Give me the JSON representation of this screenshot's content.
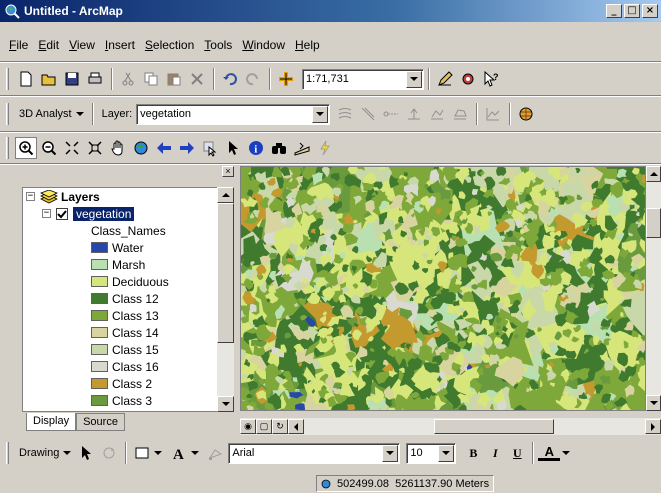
{
  "window": {
    "title": "Untitled - ArcMap",
    "app_icon": "globe-magnifier-icon"
  },
  "menu": [
    {
      "label": "File",
      "key": "F",
      "rest": "ile"
    },
    {
      "label": "Edit",
      "key": "E",
      "rest": "dit"
    },
    {
      "label": "View",
      "key": "V",
      "rest": "iew"
    },
    {
      "label": "Insert",
      "key": "I",
      "rest": "nsert"
    },
    {
      "label": "Selection",
      "key": "S",
      "rest": "election"
    },
    {
      "label": "Tools",
      "key": "T",
      "rest": "ools"
    },
    {
      "label": "Window",
      "key": "W",
      "rest": "indow"
    },
    {
      "label": "Help",
      "key": "H",
      "rest": "elp"
    }
  ],
  "standard_toolbar": {
    "scale": "1:71,731"
  },
  "analyst_toolbar": {
    "extension_label": "3D Analyst",
    "layer_label": "Layer:",
    "layer_value": "vegetation"
  },
  "toc": {
    "root": "Layers",
    "layer": "vegetation",
    "field": "Class_Names",
    "classes": [
      {
        "label": "Water",
        "color": "#2748a8"
      },
      {
        "label": "Marsh",
        "color": "#b9e0b0"
      },
      {
        "label": "Deciduous",
        "color": "#d6e67a"
      },
      {
        "label": "Class 12",
        "color": "#3f7a2e"
      },
      {
        "label": "Class 13",
        "color": "#7ea83a"
      },
      {
        "label": "Class 14",
        "color": "#d8d4a0"
      },
      {
        "label": "Class 15",
        "color": "#c9d8a8"
      },
      {
        "label": "Class 16",
        "color": "#d8dad0"
      },
      {
        "label": "Class 2",
        "color": "#c49a2e"
      },
      {
        "label": "Class 3",
        "color": "#6a9a3e"
      }
    ],
    "tabs": [
      "Display",
      "Source"
    ]
  },
  "drawing_toolbar": {
    "label": "Drawing",
    "font": "Arial",
    "font_size": "10",
    "bold": "B",
    "italic": "I",
    "underline": "U",
    "font_color_label": "A"
  },
  "status": {
    "coords": "502499.08  5261137.90 Meters"
  }
}
